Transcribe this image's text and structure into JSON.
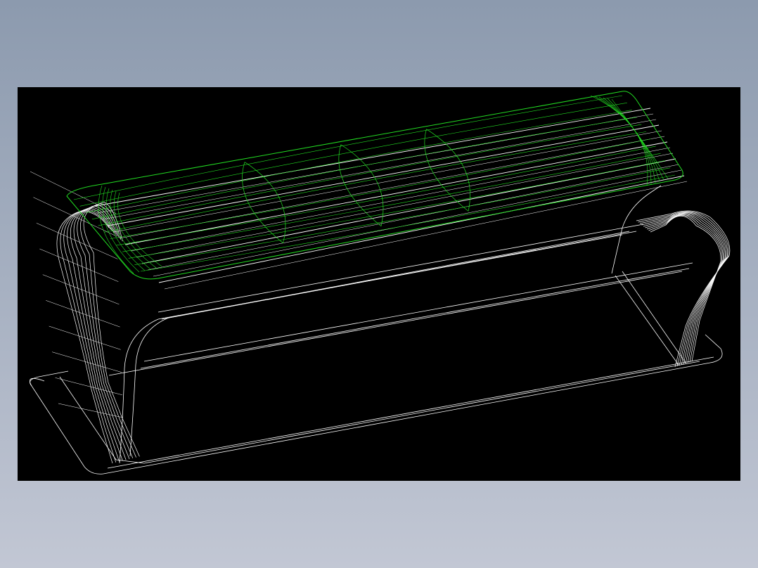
{
  "view": {
    "background": "#000000",
    "frame_gradient": [
      "#8c9aae",
      "#c2c7d4"
    ]
  },
  "colors": {
    "base_wireframe": "#ffffff",
    "cushion_wireframe": "#22dd22"
  },
  "parts": [
    {
      "name": "base-frame",
      "color": "#ffffff"
    },
    {
      "name": "seat-cushion",
      "color": "#22dd22"
    }
  ]
}
